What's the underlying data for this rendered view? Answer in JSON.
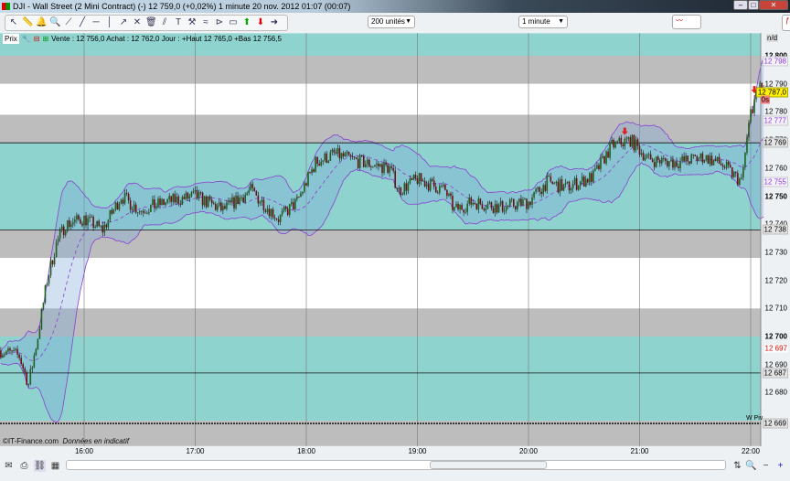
{
  "window": {
    "title": "DJI - Wall Street (2 Mini Contract) (-)   12 759,0 (+0,02%)   1 minute  20 nov. 2012 01:07 (00:07)",
    "min": "–",
    "max": "□",
    "close": "✕"
  },
  "toolbar": {
    "icons": [
      "pointer",
      "ruler",
      "alarm",
      "zoom",
      "segment",
      "line",
      "horizontal-line",
      "vertical-line",
      "trend",
      "fibonacci",
      "trash",
      "parallel",
      "text",
      "tools",
      "regression",
      "channel",
      "rectangle",
      "buy-arrow",
      "sell-arrow",
      "right-arrow"
    ],
    "units_select": "200 unités",
    "interval_select": "1 minute"
  },
  "infobar": {
    "label": "Prix",
    "quote": "Vente : 12 756,0 Achat : 12 762,0 Jour : +Haut 12 765,0 +Bas 12 756,5",
    "nd": "n/d"
  },
  "footer": {
    "copyright": "©IT-Finance.com",
    "note": "Données en indicatif"
  },
  "colors": {
    "teal": "#8fd3cf",
    "grey": "#bdbdbd",
    "white": "#ffffff",
    "bull": "#1f5f1f",
    "bear": "#6b1010",
    "band_fill": "#7da9d8",
    "purple": "#8a3fd0",
    "sell_arrow": "#e02020"
  },
  "chart_data": {
    "type": "candlestick",
    "instrument": "DJI - Wall Street (2 Mini Contract)",
    "interval": "1 minute",
    "ylim": [
      12661,
      12808
    ],
    "x_ticks": [
      "16:00",
      "17:00",
      "18:00",
      "19:00",
      "20:00",
      "21:00",
      "22:00"
    ],
    "y_ticks": [
      "12 800",
      "12 790",
      "12 780",
      "12 770",
      "12 760",
      "12 750",
      "12 740",
      "12 730",
      "12 720",
      "12 710",
      "12 700",
      "12 690",
      "12 680"
    ],
    "y_tick_values": [
      12800,
      12790,
      12780,
      12770,
      12760,
      12750,
      12740,
      12730,
      12720,
      12710,
      12700,
      12690,
      12680
    ],
    "bold_ticks": [
      12800,
      12750,
      12700
    ],
    "price_path": [
      [
        "15:15",
        12695
      ],
      [
        "15:25",
        12693
      ],
      [
        "15:30",
        12683
      ],
      [
        "15:35",
        12700
      ],
      [
        "15:40",
        12720
      ],
      [
        "15:45",
        12733
      ],
      [
        "15:50",
        12740
      ],
      [
        "16:00",
        12742
      ],
      [
        "16:10",
        12738
      ],
      [
        "16:20",
        12750
      ],
      [
        "16:30",
        12745
      ],
      [
        "16:45",
        12748
      ],
      [
        "17:00",
        12750
      ],
      [
        "17:15",
        12745
      ],
      [
        "17:30",
        12752
      ],
      [
        "17:45",
        12742
      ],
      [
        "17:55",
        12748
      ],
      [
        "18:05",
        12762
      ],
      [
        "18:15",
        12765
      ],
      [
        "18:30",
        12762
      ],
      [
        "18:45",
        12760
      ],
      [
        "18:50",
        12752
      ],
      [
        "19:00",
        12756
      ],
      [
        "19:15",
        12752
      ],
      [
        "19:20",
        12745
      ],
      [
        "19:30",
        12748
      ],
      [
        "19:45",
        12746
      ],
      [
        "20:00",
        12748
      ],
      [
        "20:10",
        12755
      ],
      [
        "20:20",
        12753
      ],
      [
        "20:35",
        12757
      ],
      [
        "20:45",
        12768
      ],
      [
        "20:55",
        12770
      ],
      [
        "21:05",
        12763
      ],
      [
        "21:20",
        12762
      ],
      [
        "21:35",
        12764
      ],
      [
        "21:45",
        12761
      ],
      [
        "21:55",
        12755
      ],
      [
        "22:00",
        12780
      ],
      [
        "22:05",
        12790
      ],
      [
        "22:07",
        12787
      ]
    ],
    "zones": [
      {
        "from": 12808,
        "to": 12800,
        "kind": "teal"
      },
      {
        "from": 12800,
        "to": 12790,
        "kind": "grey"
      },
      {
        "from": 12790,
        "to": 12779,
        "kind": "white"
      },
      {
        "from": 12779,
        "to": 12769,
        "kind": "grey"
      },
      {
        "from": 12769,
        "to": 12738,
        "kind": "teal"
      },
      {
        "from": 12738,
        "to": 12728,
        "kind": "grey"
      },
      {
        "from": 12728,
        "to": 12710,
        "kind": "white"
      },
      {
        "from": 12710,
        "to": 12700,
        "kind": "grey"
      },
      {
        "from": 12700,
        "to": 12670,
        "kind": "teal"
      },
      {
        "from": 12670,
        "to": 12661,
        "kind": "grey"
      }
    ],
    "levels": [
      {
        "value": 12769,
        "label": "12 769"
      },
      {
        "value": 12738,
        "label": "12 738"
      },
      {
        "value": 12687,
        "label": "12 687"
      },
      {
        "value": 12669,
        "label": "12 669",
        "style": "dotted",
        "tag": "W Piv"
      }
    ],
    "indicator_labels": [
      {
        "value": 12798,
        "label": "12 798"
      },
      {
        "value": 12777,
        "label": "12 777"
      },
      {
        "value": 12755,
        "label": "12 755"
      }
    ],
    "last_price": {
      "value": 12787,
      "label": "12 787,0",
      "countdown": "0s"
    },
    "low_marker": {
      "value": 12697,
      "label": "12 697"
    },
    "sell_signals": [
      "20:52",
      "22:02"
    ]
  }
}
